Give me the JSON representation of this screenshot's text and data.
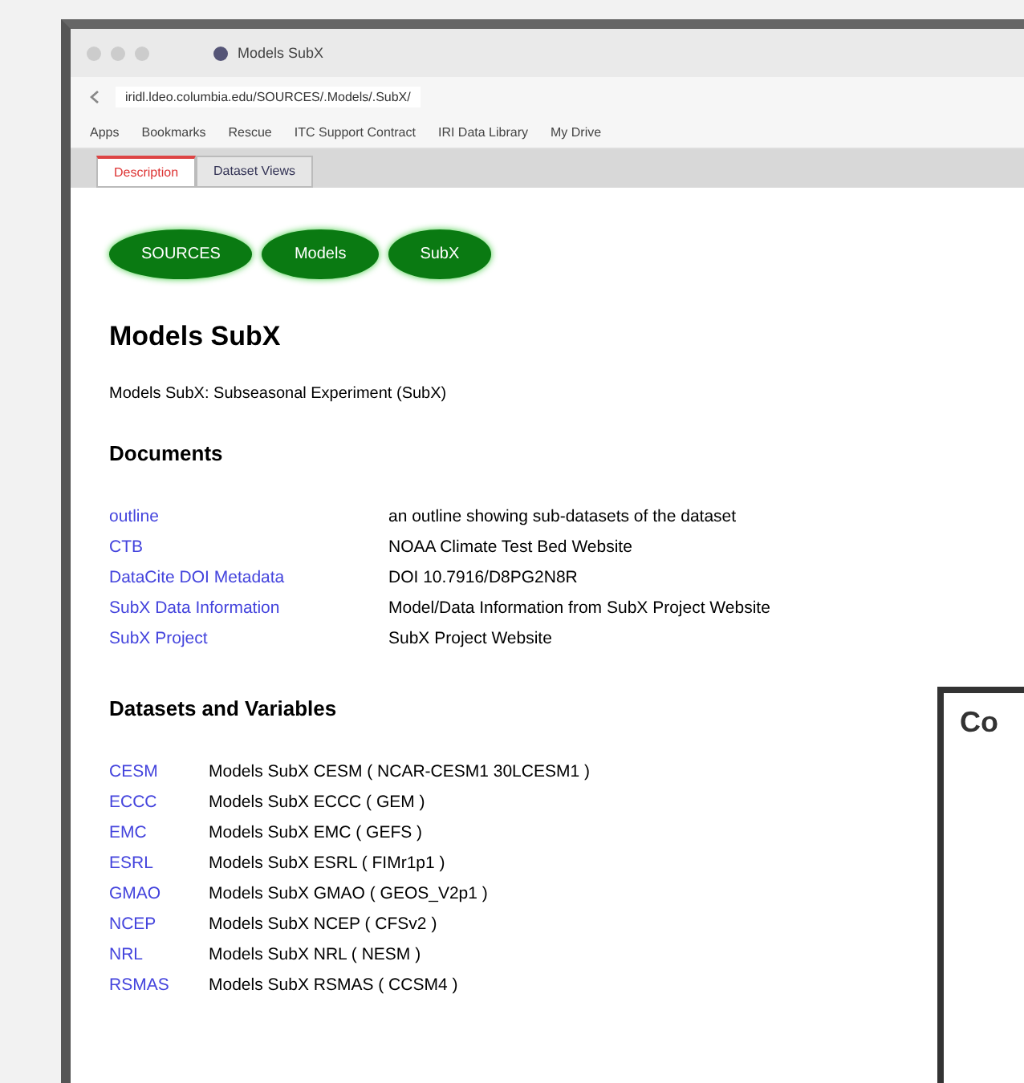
{
  "browser": {
    "tab_title": "Models SubX",
    "url": "iridl.ldeo.columbia.edu/SOURCES/.Models/.SubX/",
    "bookmarks": [
      "Apps",
      "Bookmarks",
      "Rescue",
      "ITC Support Contract",
      "IRI Data Library",
      "My Drive"
    ]
  },
  "page_tabs": [
    {
      "label": "Description",
      "selected": true
    },
    {
      "label": "Dataset Views",
      "selected": false
    }
  ],
  "breadcrumbs": [
    "SOURCES",
    "Models",
    "SubX"
  ],
  "title": "Models SubX",
  "description": "Models SubX: Subseasonal Experiment (SubX)",
  "documents": {
    "heading": "Documents",
    "rows": [
      {
        "link": "outline",
        "text": "an outline showing sub-datasets of the dataset"
      },
      {
        "link": "CTB",
        "text": "NOAA Climate Test Bed Website"
      },
      {
        "link": "DataCite DOI Metadata",
        "text": "DOI 10.7916/D8PG2N8R"
      },
      {
        "link": "SubX Data Information",
        "text": "Model/Data Information from SubX Project Website"
      },
      {
        "link": "SubX Project",
        "text": "SubX Project Website"
      }
    ]
  },
  "datasets": {
    "heading": "Datasets and Variables",
    "rows": [
      {
        "link": "CESM",
        "text": "Models SubX CESM ( NCAR-CESM1 30LCESM1 )"
      },
      {
        "link": "ECCC",
        "text": "Models SubX ECCC ( GEM )"
      },
      {
        "link": "EMC",
        "text": "Models SubX EMC ( GEFS )"
      },
      {
        "link": "ESRL",
        "text": "Models SubX ESRL ( FIMr1p1 )"
      },
      {
        "link": "GMAO",
        "text": "Models SubX GMAO ( GEOS_V2p1 )"
      },
      {
        "link": "NCEP",
        "text": "Models SubX NCEP ( CFSv2 )"
      },
      {
        "link": "NRL",
        "text": "Models SubX NRL ( NESM )"
      },
      {
        "link": "RSMAS",
        "text": "Models SubX RSMAS ( CCSM4 )"
      }
    ]
  },
  "popup": {
    "title": "Co"
  }
}
